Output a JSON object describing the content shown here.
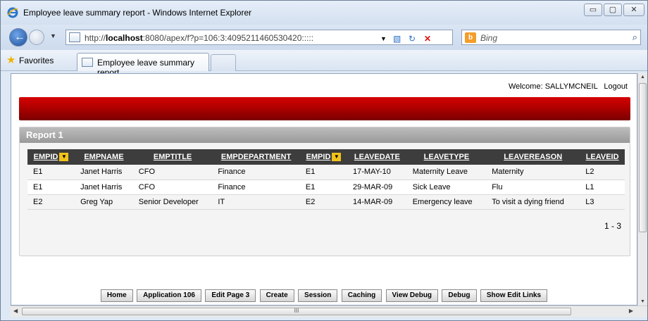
{
  "window": {
    "title": "Employee leave summary report - Windows Internet Explorer",
    "controls": {
      "minimize": "▭",
      "maximize": "▢",
      "close": "✕"
    }
  },
  "nav": {
    "url_prefix": "http://",
    "url_host": "localhost",
    "url_rest": ":8080/apex/f?p=106:3:4095211460530420:::::",
    "search_placeholder": "Bing",
    "search_engine_icon": "b"
  },
  "favorites_bar": {
    "favorites_label": "Favorites",
    "active_tab_label": "Employee leave summary report"
  },
  "page": {
    "welcome_text": "Welcome: SALLYMCNEIL",
    "logout_label": "Logout",
    "accent_color": "#b00000",
    "region_title": "Report 1",
    "columns": [
      "EMPID",
      "EMPNAME",
      "EMPTITLE",
      "EMPDEPARTMENT",
      "EMPID",
      "LEAVEDATE",
      "LEAVETYPE",
      "LEAVEREASON",
      "LEAVEID"
    ],
    "rows": [
      [
        "E1",
        "Janet Harris",
        "CFO",
        "Finance",
        "E1",
        "17-MAY-10",
        "Maternity Leave",
        "Maternity",
        "L2"
      ],
      [
        "E1",
        "Janet Harris",
        "CFO",
        "Finance",
        "E1",
        "29-MAR-09",
        "Sick Leave",
        "Flu",
        "L1"
      ],
      [
        "E2",
        "Greg Yap",
        "Senior Developer",
        "IT",
        "E2",
        "14-MAR-09",
        "Emergency leave",
        "To visit a dying friend",
        "L3"
      ]
    ],
    "pagination": "1 - 3"
  },
  "dev_toolbar": [
    "Home",
    "Application 106",
    "Edit Page 3",
    "Create",
    "Session",
    "Caching",
    "View Debug",
    "Debug",
    "Show Edit Links"
  ],
  "scrollbar": {
    "grip": "III"
  }
}
